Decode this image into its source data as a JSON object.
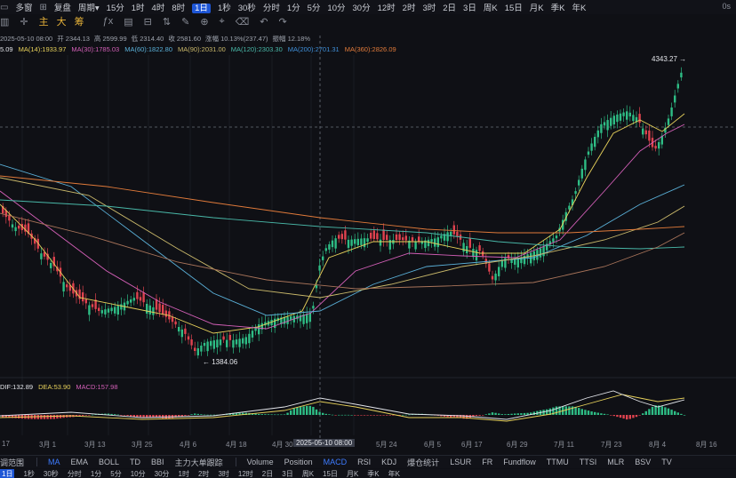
{
  "toolbar": {
    "menu_icon": "menu-icon",
    "multi_chart": "多窗",
    "replay_icon": "replay-icon",
    "replay": "复盘",
    "period_label": "周期",
    "period_chevron": "▾",
    "intervals": [
      "15分",
      "1时",
      "4时",
      "8时",
      "1日",
      "1秒",
      "30秒",
      "分时",
      "1分",
      "5分",
      "10分",
      "30分",
      "12时",
      "2时",
      "3时",
      "2日",
      "3日",
      "周K",
      "15日",
      "月K",
      "季K",
      "年K"
    ],
    "active_interval": "1日",
    "categories": [
      {
        "label": "主",
        "color": "#e8b339"
      },
      {
        "label": "大",
        "color": "#e8b339"
      },
      {
        "label": "筹",
        "color": "#e8b339"
      }
    ],
    "right_text": "0s"
  },
  "ohlc": {
    "date": "2025-05-10 08:00",
    "open": "开 2344.13",
    "high": "高 2599.99",
    "low": "低 2314.40",
    "close": "收 2581.60",
    "change": "涨幅 10.13%(237.47)",
    "amplitude": "振幅 12.18%"
  },
  "ma_legend": [
    {
      "text": "5.09",
      "color": "#e4e6eb"
    },
    {
      "text": "MA(14):1933.97",
      "color": "#e8d25b"
    },
    {
      "text": "MA(30):1785.03",
      "color": "#d35fb7"
    },
    {
      "text": "MA(60):1822.80",
      "color": "#5ab0d8"
    },
    {
      "text": "MA(90):2031.00",
      "color": "#c9b86a"
    },
    {
      "text": "MA(120):2303.30",
      "color": "#49b8a8"
    },
    {
      "text": "MA(200):2701.31",
      "color": "#3f8fd8"
    },
    {
      "text": "MA(360):2826.09",
      "color": "#e07a3a"
    }
  ],
  "macd_legend": [
    {
      "text": "DIF:132.89",
      "color": "#e4e6eb"
    },
    {
      "text": "DEA:53.90",
      "color": "#e8d25b"
    },
    {
      "text": "MACD:157.98",
      "color": "#d35fb7"
    }
  ],
  "price_labels": {
    "high": "4343.27",
    "low": "1384.06"
  },
  "date_axis": [
    "17",
    "3月 1",
    "3月 13",
    "3月 25",
    "4月 6",
    "4月 18",
    "4月 30",
    "2025-05-10 08:00",
    "5月 24",
    "6月 5",
    "6月 17",
    "6月 29",
    "7月 11",
    "7月 23",
    "8月 4",
    "8月 16"
  ],
  "indicator_tabs": {
    "left_label": "调范围",
    "main": [
      "MA",
      "EMA",
      "BOLL",
      "TD",
      "BBI",
      "主力大单跟踪"
    ],
    "active_main": "MA",
    "sub": [
      "Volume",
      "Position",
      "MACD",
      "RSI",
      "KDJ",
      "爆仓统计",
      "LSUR",
      "FR",
      "Fundflow",
      "TTMU",
      "TTSI",
      "MLR",
      "BSV",
      "TV"
    ],
    "active_sub": "MACD"
  },
  "bottom_strip": [
    "1日",
    "1秒",
    "30秒",
    "分时",
    "1分",
    "5分",
    "10分",
    "30分",
    "1时",
    "2时",
    "3时",
    "12时",
    "2日",
    "3日",
    "周K",
    "15日",
    "月K",
    "季K",
    "年K"
  ],
  "colors": {
    "up": "#2ebd85",
    "down": "#e0434f",
    "bg": "#0f1015"
  },
  "chart_data": {
    "type": "candlestick",
    "title": "",
    "x_ticks": [
      "17",
      "3月 1",
      "3月 13",
      "3月 25",
      "4月 6",
      "4月 18",
      "4月 30",
      "5月 24",
      "6月 5",
      "6月 17",
      "6月 29",
      "7月 11",
      "7月 23",
      "8月 4",
      "8月 16"
    ],
    "price_range": [
      1300,
      4500
    ],
    "high_label": 4343.27,
    "low_label": 1384.06,
    "ma_series": [
      "MA(14)",
      "MA(30)",
      "MA(60)",
      "MA(90)",
      "MA(120)",
      "MA(200)",
      "MA(360)"
    ]
  }
}
